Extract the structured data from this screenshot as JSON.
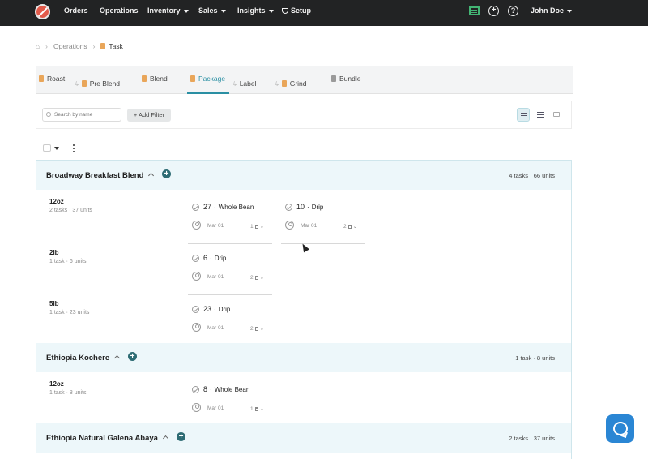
{
  "nav": {
    "items": [
      "Orders",
      "Operations",
      "Inventory",
      "Sales",
      "Insights",
      "Setup"
    ],
    "user": "John Doe",
    "help_symbol": "?",
    "add_symbol": "+"
  },
  "breadcrumb": {
    "home_symbol": "⌂",
    "section": "Operations",
    "current": "Task"
  },
  "tabs": [
    "Roast",
    "Pre Blend",
    "Blend",
    "Package",
    "Label",
    "Grind",
    "Bundle"
  ],
  "active_tab": "Package",
  "toolbar": {
    "search_placeholder": "Search by name",
    "filter_label": "+ Add Filter"
  },
  "groups": [
    {
      "name": "Broadway Breakfast Blend",
      "summary": "4 tasks · 66 units",
      "rows": [
        {
          "size": "12oz",
          "sub": "2 tasks · 37 units",
          "tasks": [
            {
              "qty": "27",
              "type": "Whole Bean",
              "date": "Mar 01",
              "count": "1"
            },
            {
              "qty": "10",
              "type": "Drip",
              "date": "Mar 01",
              "count": "2"
            }
          ]
        },
        {
          "size": "2lb",
          "sub": "1 task · 6 units",
          "tasks": [
            {
              "qty": "6",
              "type": "Drip",
              "date": "Mar 01",
              "count": "2"
            }
          ]
        },
        {
          "size": "5lb",
          "sub": "1 task · 23 units",
          "tasks": [
            {
              "qty": "23",
              "type": "Drip",
              "date": "Mar 01",
              "count": "2"
            }
          ]
        }
      ]
    },
    {
      "name": "Ethiopia Kochere",
      "summary": "1 task · 8 units",
      "rows": [
        {
          "size": "12oz",
          "sub": "1 task · 8 units",
          "tasks": [
            {
              "qty": "8",
              "type": "Whole Bean",
              "date": "Mar 01",
              "count": "1"
            }
          ]
        }
      ]
    },
    {
      "name": "Ethiopia Natural Galena Abaya",
      "summary": "2 tasks · 37 units",
      "rows": []
    }
  ],
  "colors": {
    "accent": "#2a8fa3",
    "nav_bg": "#222324",
    "group_bg": "#edf7fa",
    "plus": "#2d6b73",
    "chat": "#2a86d4"
  }
}
